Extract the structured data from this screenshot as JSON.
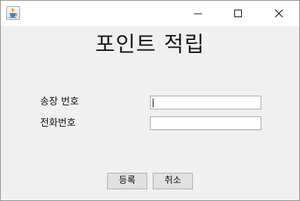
{
  "window": {
    "title": ""
  },
  "titlebar": {
    "app_icon": "java-coffee-cup-icon",
    "minimize_icon": "minimize-icon",
    "maximize_icon": "maximize-icon",
    "close_icon": "close-icon"
  },
  "form": {
    "heading": "포인트 적립",
    "fields": [
      {
        "label": "송장 번호",
        "value": ""
      },
      {
        "label": "전화번호",
        "value": ""
      }
    ],
    "register_label": "등록",
    "cancel_label": "취소"
  },
  "colors": {
    "window_background": "#f0f0f0",
    "titlebar_background": "#ffffff",
    "button_background": "#e1e1e1",
    "field_border": "#a4a4a4"
  }
}
